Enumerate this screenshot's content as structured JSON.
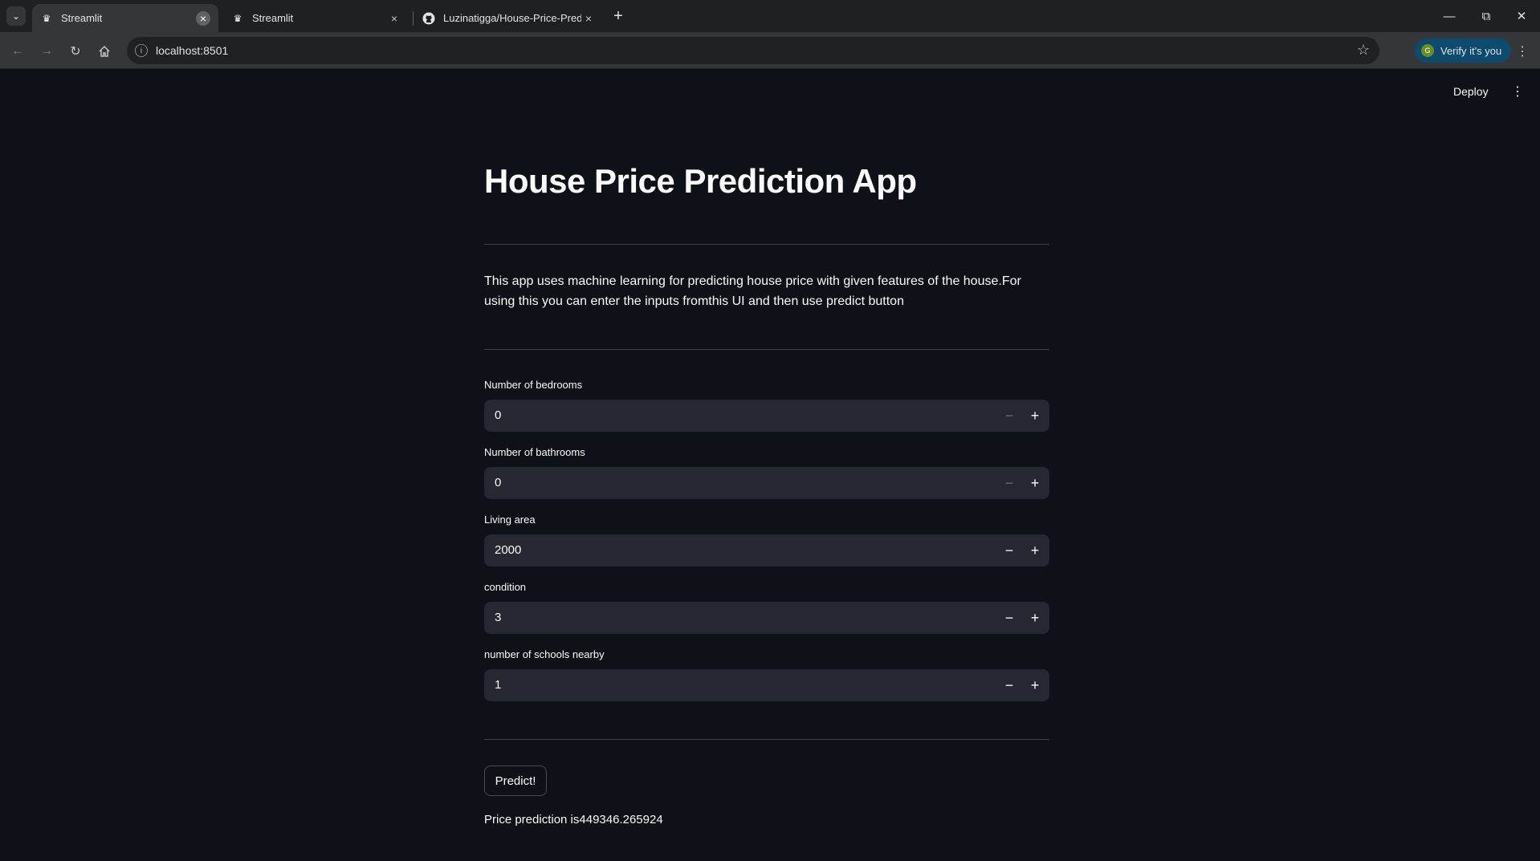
{
  "browser": {
    "tabs": [
      {
        "title": "Streamlit",
        "favicon": "streamlit-crown-icon",
        "active": true
      },
      {
        "title": "Streamlit",
        "favicon": "streamlit-crown-icon",
        "active": false
      },
      {
        "title": "Luzinatigga/House-Price-Predic",
        "favicon": "github-icon",
        "active": false
      }
    ],
    "url": "localhost:8501",
    "verify_label": "Verify it's you",
    "verify_avatar": "G"
  },
  "header": {
    "deploy_label": "Deploy"
  },
  "app": {
    "title": "House Price Prediction App",
    "description": "This app uses machine learning for predicting house price with given features of the house.For using this you can enter the inputs fromthis UI and then use predict button",
    "inputs": [
      {
        "label": "Number of bedrooms",
        "value": "0"
      },
      {
        "label": "Number of bathrooms",
        "value": "0"
      },
      {
        "label": "Living area",
        "value": "2000"
      },
      {
        "label": "condition",
        "value": "3"
      },
      {
        "label": "number of schools nearby",
        "value": "1"
      }
    ],
    "predict_label": "Predict!",
    "result_text": "Price prediction is449346.265924"
  },
  "colors": {
    "background": "#0e1117",
    "input_bg": "#262730",
    "text": "#fafafa",
    "chrome_tabbar": "#1f2023",
    "chrome_toolbar": "#35363a"
  }
}
